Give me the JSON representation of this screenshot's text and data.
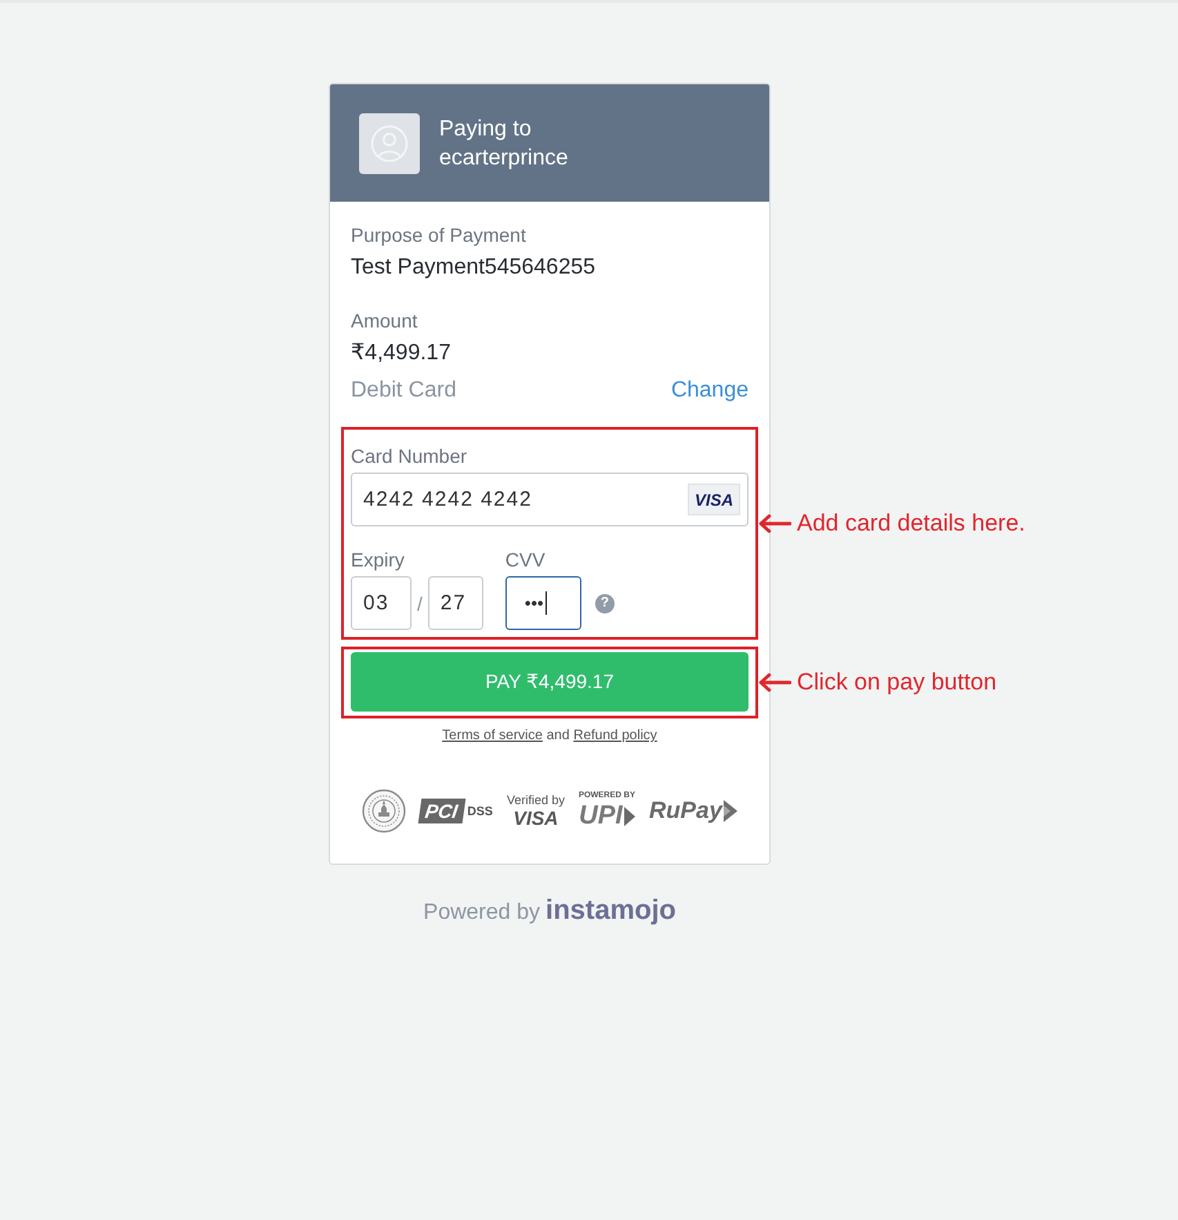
{
  "header": {
    "title": "Paying to",
    "merchant": "ecarterprince"
  },
  "details": [
    {
      "label": "Purpose of Payment",
      "value": "Test Payment545646255"
    },
    {
      "label": "Amount",
      "value": "₹4,499.17"
    }
  ],
  "payment_method": {
    "name": "Debit Card",
    "action": "Change"
  },
  "card_form": {
    "annotation": "Add card details here.",
    "card_number": {
      "label": "Card Number",
      "value": "4242 4242 4242",
      "brand": "VISA"
    },
    "expiry": {
      "label": "Expiry",
      "month": "03",
      "separator": "/",
      "year": "27"
    },
    "cvv": {
      "label": "CVV",
      "value": "•••",
      "focused": true,
      "help": "?"
    }
  },
  "pay_button": {
    "label": "PAY ₹4,499.17",
    "annotation": "Click on pay button"
  },
  "legal": [
    {
      "kind": "link",
      "text": "Terms of service"
    },
    {
      "kind": "text",
      "text": " and "
    },
    {
      "kind": "link",
      "text": "Refund policy"
    }
  ],
  "trust_badges": [
    {
      "kind": "seal"
    },
    {
      "kind": "pci",
      "mark": "PCI",
      "text": "DSS"
    },
    {
      "kind": "verified",
      "caption": "Verified by",
      "brand": "VISA"
    },
    {
      "kind": "upi",
      "caption": "POWERED BY",
      "brand": "UPI"
    },
    {
      "kind": "rupay",
      "brand": "RuPay"
    }
  ],
  "footer": {
    "text": "Powered by",
    "brand": "instamojo"
  }
}
